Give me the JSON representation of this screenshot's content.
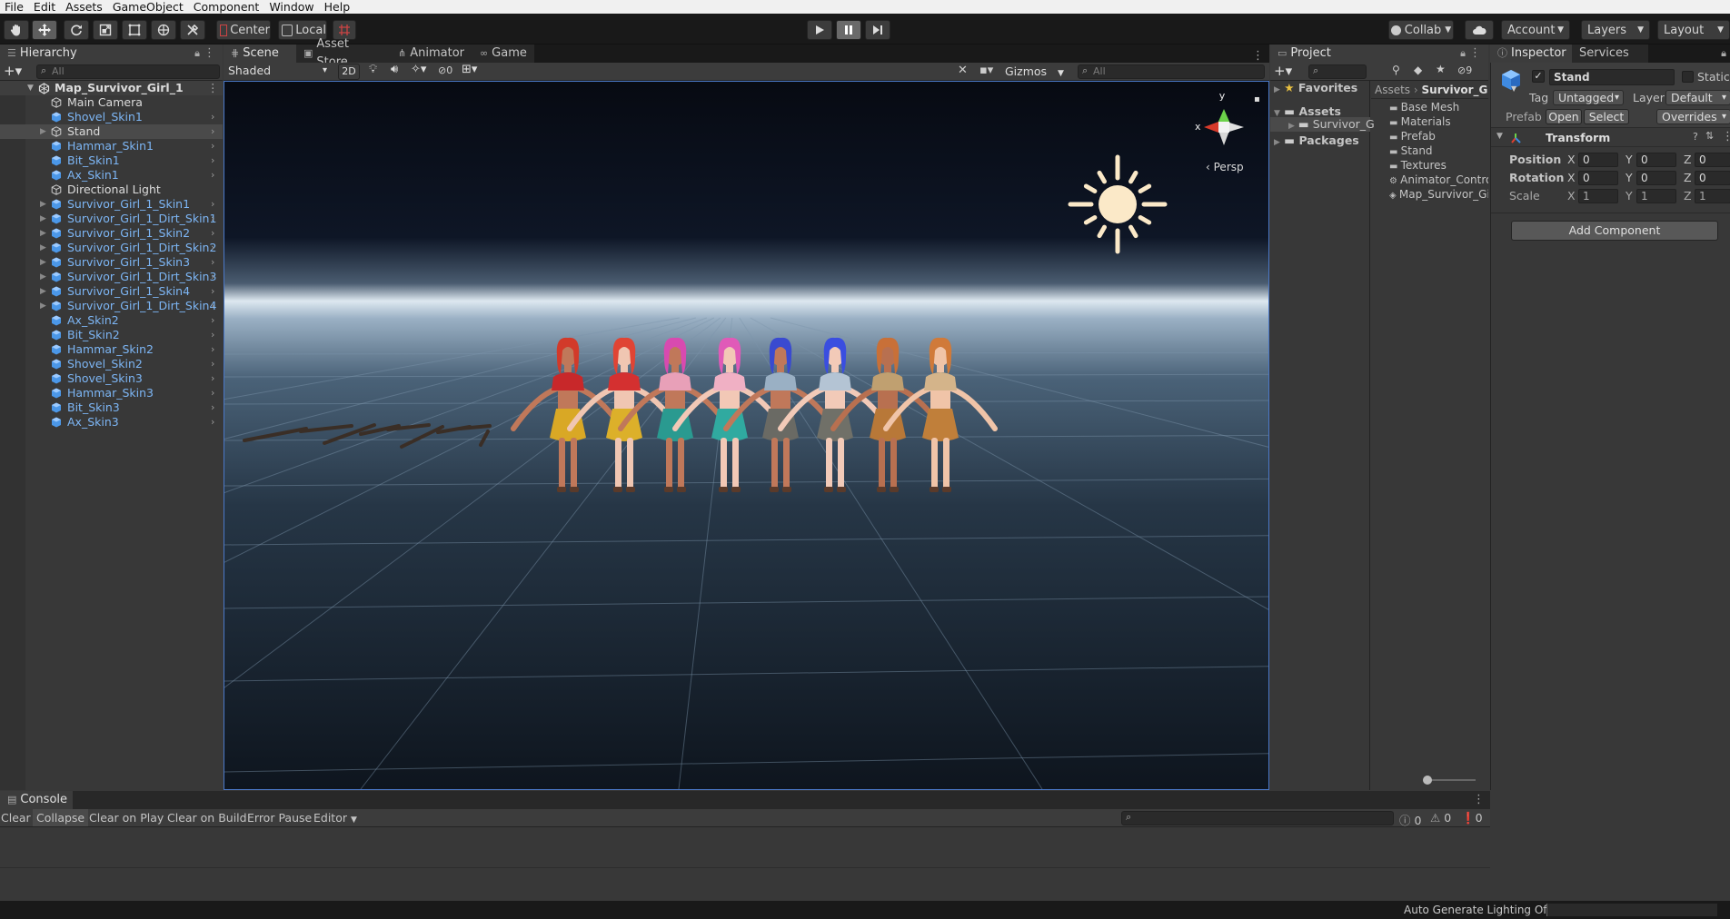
{
  "menu": [
    "File",
    "Edit",
    "Assets",
    "GameObject",
    "Component",
    "Window",
    "Help"
  ],
  "toolbar": {
    "pivot_mode": "Center",
    "pivot_rotation": "Local",
    "collab": "Collab",
    "account": "Account",
    "layers": "Layers",
    "layout": "Layout"
  },
  "hierarchy": {
    "tab": "Hierarchy",
    "search_placeholder": "All",
    "scene": "Map_Survivor_Girl_1",
    "items": [
      {
        "label": "Main Camera",
        "color": "white",
        "arrow": false,
        "chevron": false
      },
      {
        "label": "Shovel_Skin1",
        "color": "blue",
        "arrow": false,
        "chevron": true
      },
      {
        "label": "Stand",
        "color": "white",
        "arrow": true,
        "chevron": true,
        "selected": true
      },
      {
        "label": "Hammar_Skin1",
        "color": "blue",
        "arrow": false,
        "chevron": true
      },
      {
        "label": "Bit_Skin1",
        "color": "blue",
        "arrow": false,
        "chevron": true
      },
      {
        "label": "Ax_Skin1",
        "color": "blue",
        "arrow": false,
        "chevron": true
      },
      {
        "label": "Directional Light",
        "color": "white",
        "arrow": false,
        "chevron": false
      },
      {
        "label": "Survivor_Girl_1_Skin1",
        "color": "blue",
        "arrow": true,
        "chevron": true
      },
      {
        "label": "Survivor_Girl_1_Dirt_Skin1",
        "color": "blue",
        "arrow": true,
        "chevron": true
      },
      {
        "label": "Survivor_Girl_1_Skin2",
        "color": "blue",
        "arrow": true,
        "chevron": true
      },
      {
        "label": "Survivor_Girl_1_Dirt_Skin2",
        "color": "blue",
        "arrow": true,
        "chevron": true
      },
      {
        "label": "Survivor_Girl_1_Skin3",
        "color": "blue",
        "arrow": true,
        "chevron": true
      },
      {
        "label": "Survivor_Girl_1_Dirt_Skin3",
        "color": "blue",
        "arrow": true,
        "chevron": true
      },
      {
        "label": "Survivor_Girl_1_Skin4",
        "color": "blue",
        "arrow": true,
        "chevron": true
      },
      {
        "label": "Survivor_Girl_1_Dirt_Skin4",
        "color": "blue",
        "arrow": true,
        "chevron": true
      },
      {
        "label": "Ax_Skin2",
        "color": "blue",
        "arrow": false,
        "chevron": true
      },
      {
        "label": "Bit_Skin2",
        "color": "blue",
        "arrow": false,
        "chevron": true
      },
      {
        "label": "Hammar_Skin2",
        "color": "blue",
        "arrow": false,
        "chevron": true
      },
      {
        "label": "Shovel_Skin2",
        "color": "blue",
        "arrow": false,
        "chevron": true
      },
      {
        "label": "Shovel_Skin3",
        "color": "blue",
        "arrow": false,
        "chevron": true
      },
      {
        "label": "Hammar_Skin3",
        "color": "blue",
        "arrow": false,
        "chevron": true
      },
      {
        "label": "Bit_Skin3",
        "color": "blue",
        "arrow": false,
        "chevron": true
      },
      {
        "label": "Ax_Skin3",
        "color": "blue",
        "arrow": false,
        "chevron": true
      }
    ]
  },
  "scene_tabs": [
    "Scene",
    "Asset Store",
    "Animator",
    "Game"
  ],
  "scene_toolbar": {
    "draw_mode": "Shaded",
    "mode_2d": "2D",
    "hidden_count": "0",
    "gizmos": "Gizmos",
    "search_placeholder": "All"
  },
  "gizmo": {
    "y": "y",
    "x": "x",
    "persp": "Persp"
  },
  "characters": [
    {
      "hair": "#d23a2a",
      "top": "#c8282a",
      "skirt": "#d9a825",
      "skin": "#c0785a"
    },
    {
      "hair": "#e04434",
      "top": "#d43030",
      "skirt": "#dcb02a",
      "skin": "#f0c6b2"
    },
    {
      "hair": "#d84ab0",
      "top": "#e8a0b8",
      "skirt": "#2a9a90",
      "skin": "#c0785a"
    },
    {
      "hair": "#e05ab8",
      "top": "#f0b0c4",
      "skirt": "#30aaa0",
      "skin": "#f2c8b6"
    },
    {
      "hair": "#3a4ad0",
      "top": "#9ab0c4",
      "skirt": "#6a6a64",
      "skin": "#c0785a"
    },
    {
      "hair": "#3a4ee0",
      "top": "#b4c4d4",
      "skirt": "#707068",
      "skin": "#f2cab8"
    },
    {
      "hair": "#c87038",
      "top": "#c0a070",
      "skirt": "#b87838",
      "skin": "#b87050"
    },
    {
      "hair": "#d07a3a",
      "top": "#d4b48a",
      "skirt": "#c07f3a",
      "skin": "#f0c4a8"
    }
  ],
  "project": {
    "tab": "Project",
    "hidden_count": "9",
    "tree": [
      {
        "label": "Favorites",
        "bold": true
      },
      {
        "label": "Assets",
        "bold": true
      },
      {
        "label": "Survivor_G",
        "bold": false
      },
      {
        "label": "Packages",
        "bold": true
      }
    ],
    "breadcrumb": [
      "Assets",
      "Survivor_Gir"
    ],
    "files": [
      "Base Mesh",
      "Materials",
      "Prefab",
      "Stand",
      "Textures",
      "Animator_Control",
      "Map_Survivor_Gir"
    ]
  },
  "inspector": {
    "tabs": [
      "Inspector",
      "Services"
    ],
    "name": "Stand",
    "static": "Static",
    "tag_label": "Tag",
    "tag": "Untagged",
    "layer_label": "Layer",
    "layer": "Default",
    "prefab_label": "Prefab",
    "open": "Open",
    "select": "Select",
    "overrides": "Overrides",
    "component": "Transform",
    "position_label": "Position",
    "rotation_label": "Rotation",
    "scale_label": "Scale",
    "axis_x": "X",
    "axis_y": "Y",
    "axis_z": "Z",
    "position": [
      "0",
      "0",
      "0"
    ],
    "rotation": [
      "0",
      "0",
      "0"
    ],
    "scale": [
      "1",
      "1",
      "1"
    ],
    "add_component": "Add Component"
  },
  "console": {
    "tab": "Console",
    "buttons": [
      "Clear",
      "Collapse",
      "Clear on Play",
      "Clear on Build",
      "Error Pause",
      "Editor"
    ],
    "counts": [
      "0",
      "0",
      "0"
    ]
  },
  "status": {
    "text": "Auto Generate Lighting Off"
  }
}
